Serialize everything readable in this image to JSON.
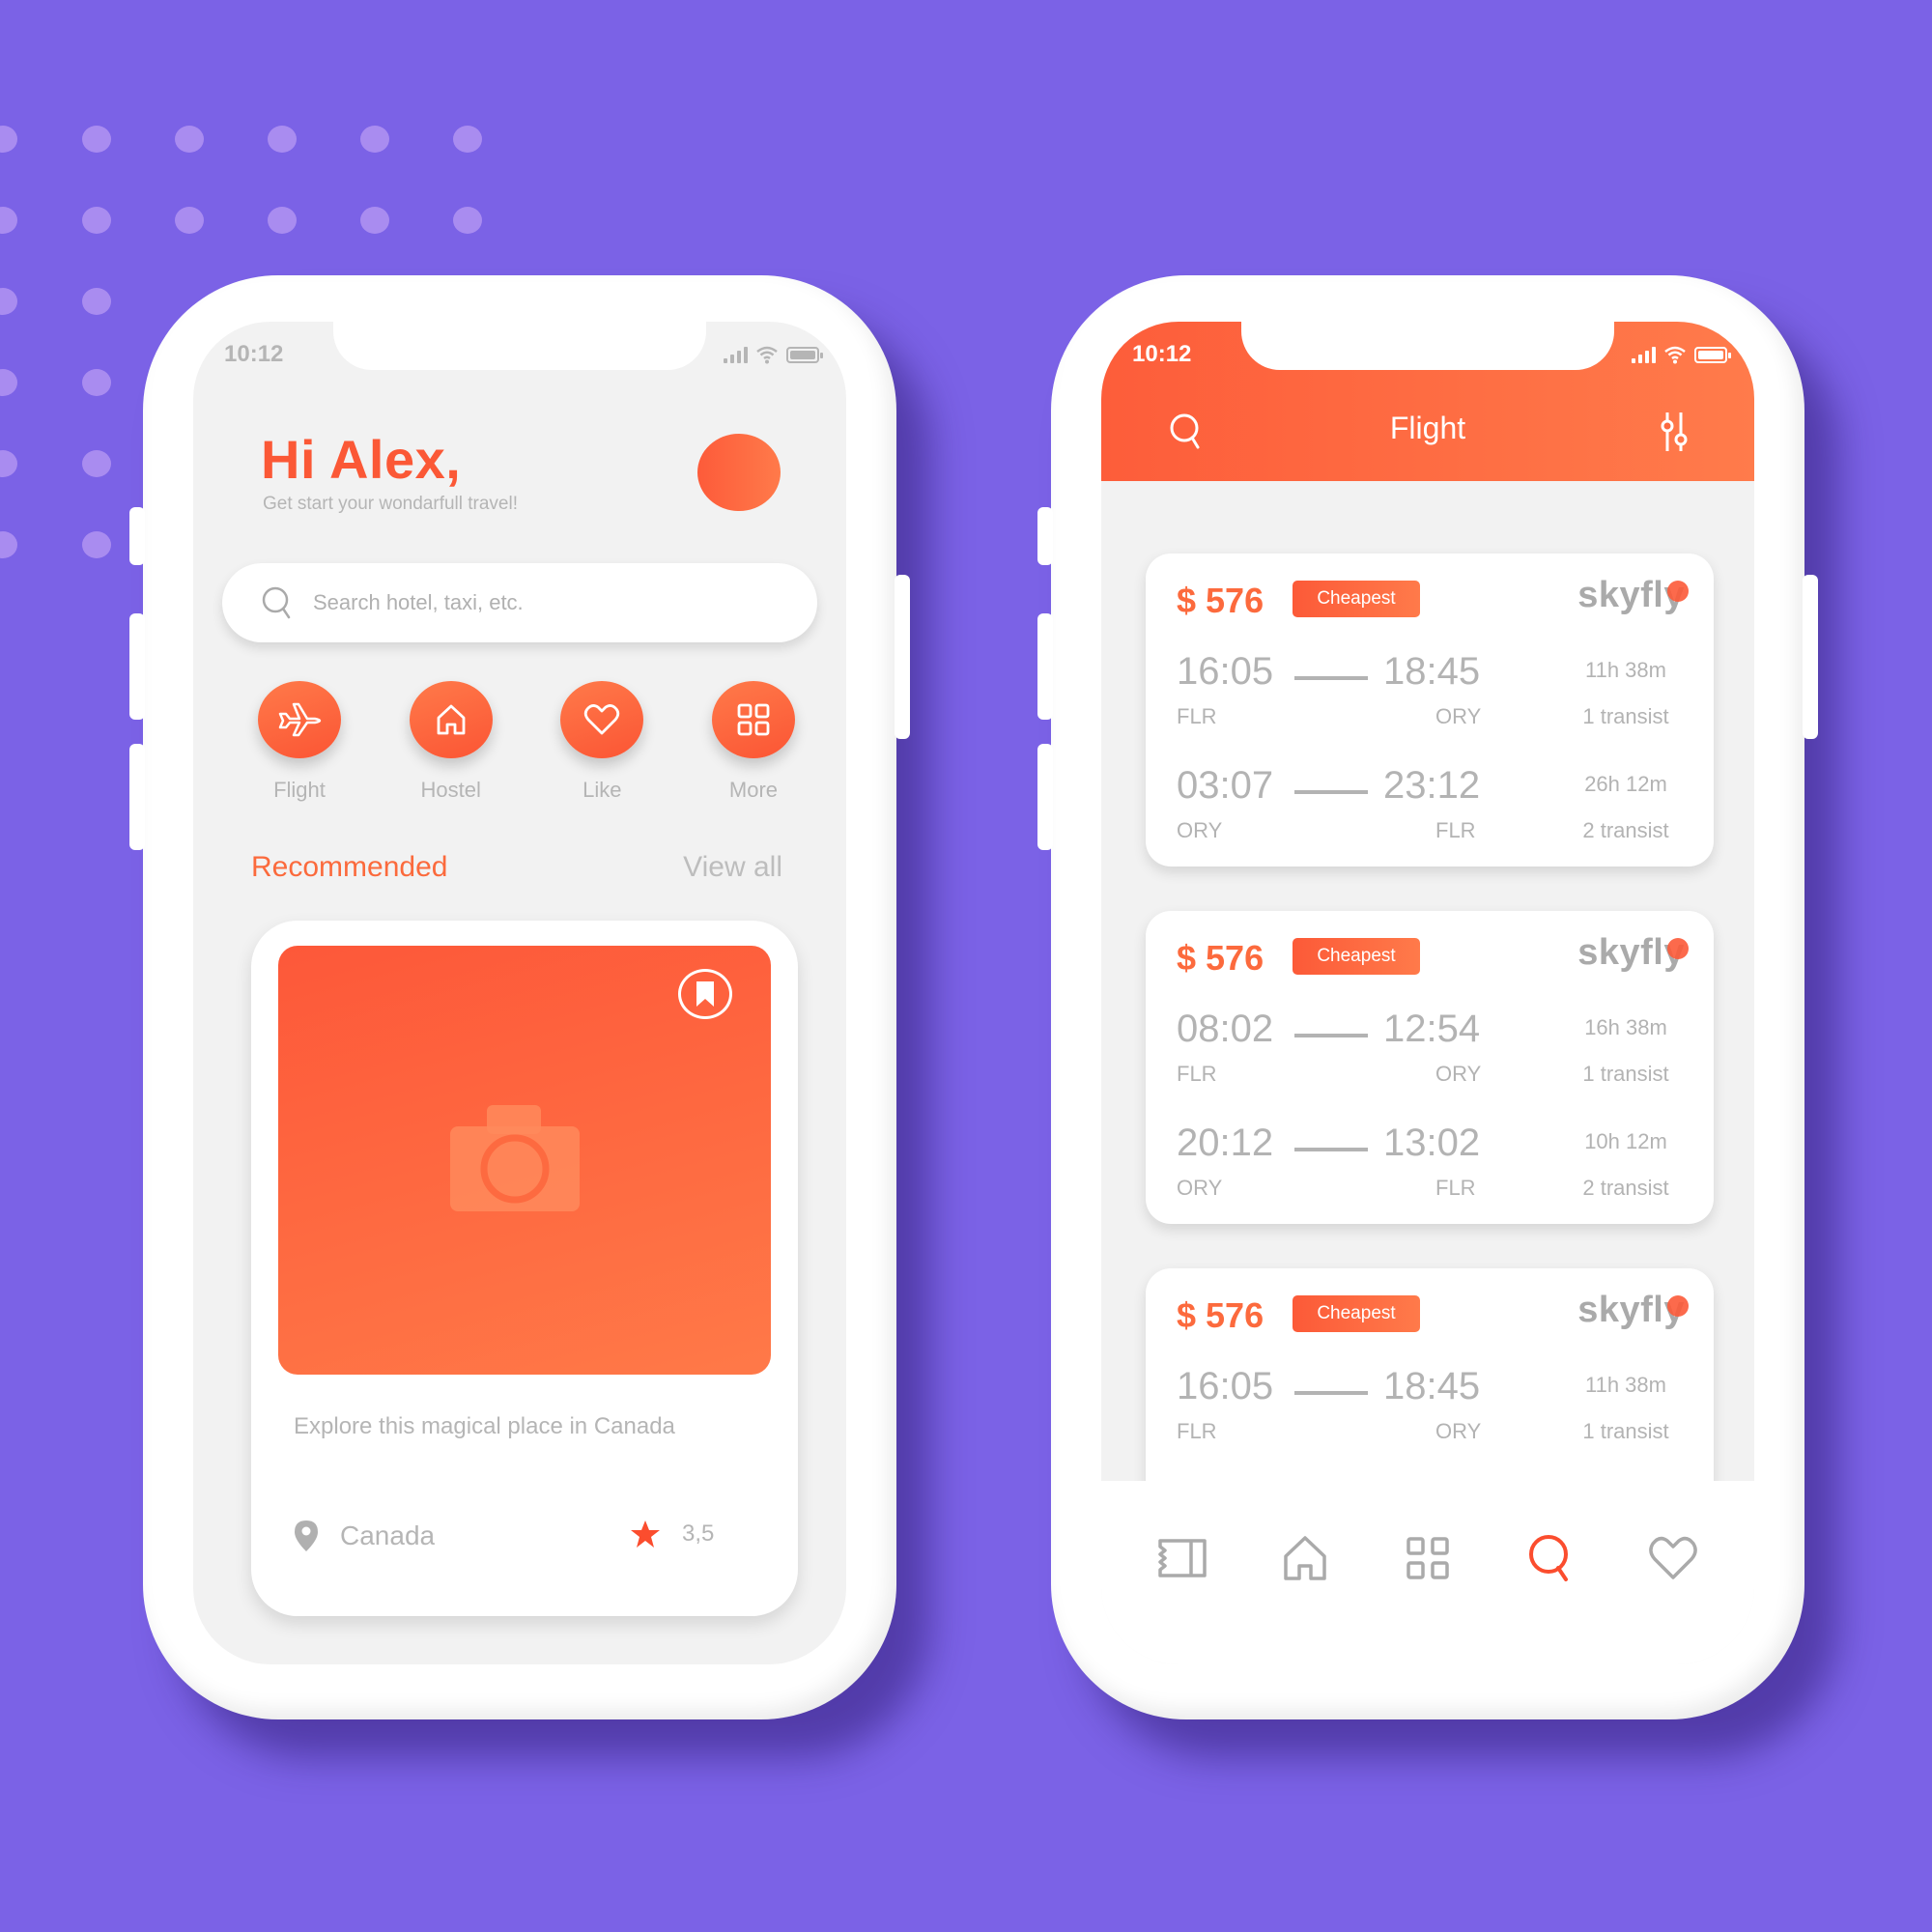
{
  "theme": {
    "background": "#7b62e6",
    "accent": "#fb5836",
    "accent_light": "#ff7a4a",
    "muted_text": "#b5b5b5"
  },
  "home_screen": {
    "status_time": "10:12",
    "greeting": "Hi Alex,",
    "subtitle": "Get start your wondarfull travel!",
    "search": {
      "placeholder": "Search hotel, taxi, etc.",
      "value": ""
    },
    "categories": [
      {
        "label": "Flight",
        "icon": "airplane-icon"
      },
      {
        "label": "Hostel",
        "icon": "house-icon"
      },
      {
        "label": "Like",
        "icon": "heart-icon"
      },
      {
        "label": "More",
        "icon": "grid-icon"
      }
    ],
    "recommended_title": "Recommended",
    "view_all_label": "View all",
    "place": {
      "description": "Explore this magical place in Canada",
      "location": "Canada",
      "rating": "3,5"
    }
  },
  "flight_screen": {
    "status_time": "10:12",
    "title": "Flight",
    "flights": [
      {
        "price": "$ 576",
        "badge": "Cheapest",
        "airline": "skyfly",
        "legs": [
          {
            "depart": "16:05",
            "arrive": "18:45",
            "from": "FLR",
            "to": "ORY",
            "duration": "11h 38m",
            "transits": "1 transist"
          },
          {
            "depart": "03:07",
            "arrive": "23:12",
            "from": "ORY",
            "to": "FLR",
            "duration": "26h 12m",
            "transits": "2 transist"
          }
        ]
      },
      {
        "price": "$ 576",
        "badge": "Cheapest",
        "airline": "skyfly",
        "legs": [
          {
            "depart": "08:02",
            "arrive": "12:54",
            "from": "FLR",
            "to": "ORY",
            "duration": "16h 38m",
            "transits": "1 transist"
          },
          {
            "depart": "20:12",
            "arrive": "13:02",
            "from": "ORY",
            "to": "FLR",
            "duration": "10h 12m",
            "transits": "2 transist"
          }
        ]
      },
      {
        "price": "$ 576",
        "badge": "Cheapest",
        "airline": "skyfly",
        "legs": [
          {
            "depart": "16:05",
            "arrive": "18:45",
            "from": "FLR",
            "to": "ORY",
            "duration": "11h 38m",
            "transits": "1 transist"
          }
        ]
      }
    ],
    "bottom_nav": [
      {
        "icon": "ticket-icon",
        "active": false
      },
      {
        "icon": "home-icon",
        "active": false
      },
      {
        "icon": "grid-icon",
        "active": false
      },
      {
        "icon": "search-icon",
        "active": true
      },
      {
        "icon": "heart-icon",
        "active": false
      }
    ]
  }
}
